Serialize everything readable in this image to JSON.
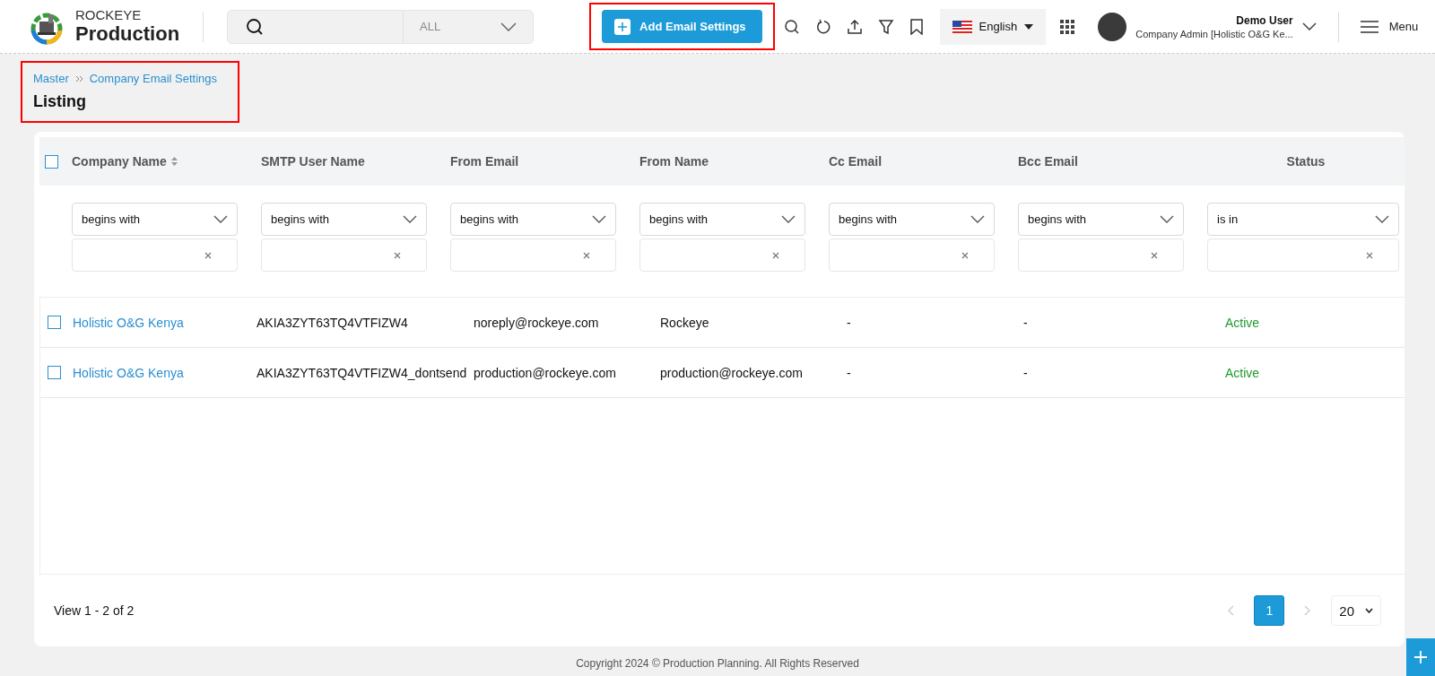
{
  "header": {
    "brand_top": "ROCKEYE",
    "brand_name": "Production",
    "search": {
      "scope": "ALL"
    },
    "add_button": {
      "label": "Add Email Settings",
      "highlighted": true
    },
    "language": "English",
    "user": {
      "name": "Demo User",
      "role": "Company Admin [Holistic O&G Ke..."
    },
    "menu_label": "Menu"
  },
  "breadcrumb": {
    "items": [
      "Master",
      "Company Email Settings"
    ],
    "title": "Listing",
    "highlighted": true
  },
  "table": {
    "all_checked": false,
    "columns": [
      {
        "label": "Company Name",
        "sortable": true,
        "operator": "begins with"
      },
      {
        "label": "SMTP User Name",
        "sortable": false,
        "operator": "begins with"
      },
      {
        "label": "From Email",
        "sortable": false,
        "operator": "begins with"
      },
      {
        "label": "From Name",
        "sortable": false,
        "operator": "begins with"
      },
      {
        "label": "Cc Email",
        "sortable": false,
        "operator": "begins with"
      },
      {
        "label": "Bcc Email",
        "sortable": false,
        "operator": "begins with"
      },
      {
        "label": "Status",
        "sortable": false,
        "operator": "is in"
      }
    ],
    "rows": [
      {
        "checked": false,
        "cells": [
          "Holistic O&G Kenya",
          "AKIA3ZYT63TQ4VTFIZW4",
          "noreply@rockeye.com",
          "Rockeye",
          "-",
          "-",
          "Active"
        ]
      },
      {
        "checked": false,
        "cells": [
          "Holistic O&G Kenya",
          "AKIA3ZYT63TQ4VTFIZW4_dontsend",
          "production@rockeye.com",
          "production@rockeye.com",
          "-",
          "-",
          "Active"
        ]
      }
    ]
  },
  "pager": {
    "summary": "View 1 - 2 of 2",
    "pages": [
      {
        "label": "1",
        "selected": true
      }
    ],
    "page_size": "20"
  },
  "footer": {
    "copyright": "Copyright 2024 © Production Planning. All Rights Reserved"
  }
}
